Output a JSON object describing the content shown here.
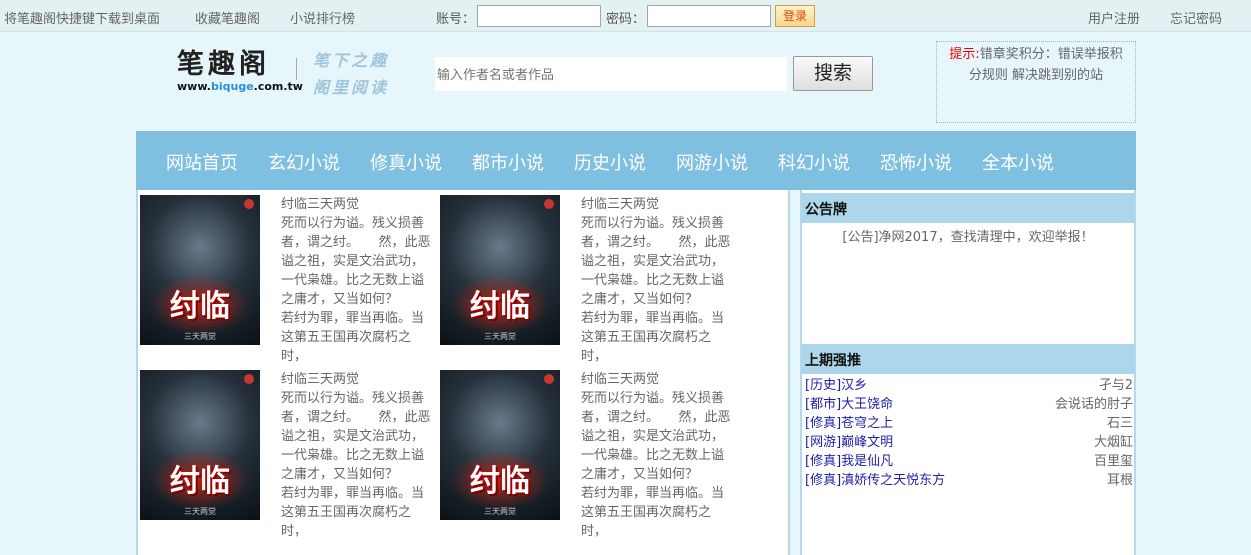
{
  "topbar": {
    "download_shortcut": "将笔趣阁快捷键下载到桌面",
    "bookmark": "收藏笔趣阁",
    "ranking": "小说排行榜",
    "account_label": "账号：",
    "password_label": "密码：",
    "login": "登录",
    "register": "用户注册",
    "forgot_password": "忘记密码"
  },
  "header": {
    "logo_text": "笔趣阁",
    "logo_url_prefix": "www.",
    "logo_url_brand": "biquge",
    "logo_url_suffix": ".com.tw",
    "slogan_line1": "笔下之趣",
    "slogan_line2": "阁里阅读",
    "search_placeholder": "输入作者名或者作品",
    "search_button": "搜索",
    "notice_prefix": "提示:",
    "notice_text": "错章奖积分：错误举报积分规则 解决跳到别的站"
  },
  "nav": [
    "网站首页",
    "玄幻小说",
    "修真小说",
    "都市小说",
    "历史小说",
    "网游小说",
    "科幻小说",
    "恐怖小说",
    "全本小说"
  ],
  "books": [
    {
      "cover_title": "纣临",
      "cover_author": "三天两觉",
      "title": "纣临三天两觉",
      "desc": "死而以行为谥。残义损善者，谓之纣。　　然，此恶谥之祖，实是文治武功，一代枭雄。比之无数上谥之庸才，又当如何？　　若纣为罪，罪当再临。当这第五王国再次腐朽之时，"
    },
    {
      "cover_title": "纣临",
      "cover_author": "三天两觉",
      "title": "纣临三天两觉",
      "desc": "死而以行为谥。残义损善者，谓之纣。　　然，此恶谥之祖，实是文治武功，一代枭雄。比之无数上谥之庸才，又当如何？　　若纣为罪，罪当再临。当这第五王国再次腐朽之时，"
    },
    {
      "cover_title": "纣临",
      "cover_author": "三天两觉",
      "title": "纣临三天两觉",
      "desc": "死而以行为谥。残义损善者，谓之纣。　　然，此恶谥之祖，实是文治武功，一代枭雄。比之无数上谥之庸才，又当如何？　　若纣为罪，罪当再临。当这第五王国再次腐朽之时，"
    },
    {
      "cover_title": "纣临",
      "cover_author": "三天两觉",
      "title": "纣临三天两觉",
      "desc": "死而以行为谥。残义损善者，谓之纣。　　然，此恶谥之祖，实是文治武功，一代枭雄。比之无数上谥之庸才，又当如何？　　若纣为罪，罪当再临。当这第五王国再次腐朽之时，"
    }
  ],
  "sidebar": {
    "notice_heading": "公告牌",
    "notice_text": "[公告]净网2017，查找清理中，欢迎举报！",
    "ranking_heading": "上期强推",
    "ranking": [
      {
        "title": "[历史]汉乡",
        "author": "孑与2"
      },
      {
        "title": "[都市]大王饶命",
        "author": "会说话的肘子"
      },
      {
        "title": "[修真]苍穹之上",
        "author": "石三"
      },
      {
        "title": "[网游]巅峰文明",
        "author": "大烟缸"
      },
      {
        "title": "[修真]我是仙凡",
        "author": "百里玺"
      },
      {
        "title": "[修真]滇娇传之天悦东方",
        "author": "耳根"
      }
    ]
  },
  "colors": {
    "page_bg": "#e7f6fb",
    "nav_bg": "#7fc0e0",
    "sidebar_head_bg": "#acd6ea",
    "link": "#1d1daa",
    "notice_red": "#e00000"
  }
}
